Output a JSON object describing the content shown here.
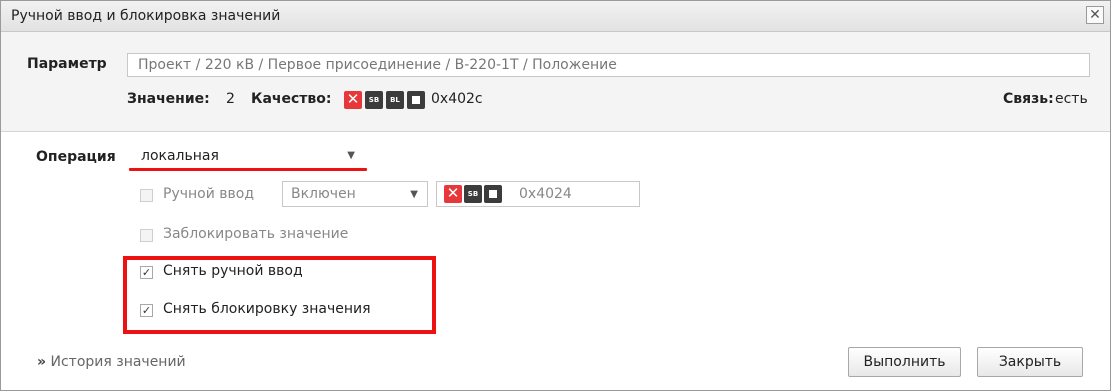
{
  "dialog": {
    "title": "Ручной ввод и блокировка значений",
    "close_symbol": "✕"
  },
  "parameter": {
    "label": "Параметр",
    "path": "Проект / 220 кВ / Первое присоединение / В-220-1Т / Положение",
    "value_label": "Значение:",
    "value": "2",
    "quality_label": "Качество:",
    "quality_code": "0x402c",
    "quality_flags": [
      "SB",
      "BL"
    ],
    "link_label": "Связь:",
    "link_value": "есть"
  },
  "operation": {
    "label": "Операция",
    "selected": "локальная"
  },
  "manual_input": {
    "label": "Ручной ввод",
    "checked": false,
    "state_selected": "Включен",
    "quality_code": "0x4024",
    "quality_flags": [
      "SB"
    ]
  },
  "block_value": {
    "label": "Заблокировать значение",
    "checked": false
  },
  "remove_manual": {
    "label": "Снять ручной ввод",
    "checked": true
  },
  "remove_block": {
    "label": "Снять блокировку значения",
    "checked": true
  },
  "footer": {
    "history_icon": "»",
    "history_label": "История значений",
    "execute_label": "Выполнить",
    "close_label": "Закрыть"
  },
  "colors": {
    "accent_red": "#ee1111",
    "quality_red": "#e8373b",
    "quality_dark": "#3c3c3c"
  },
  "icons": {
    "checkmark": "☑",
    "checkmark_glyph": "✓"
  }
}
